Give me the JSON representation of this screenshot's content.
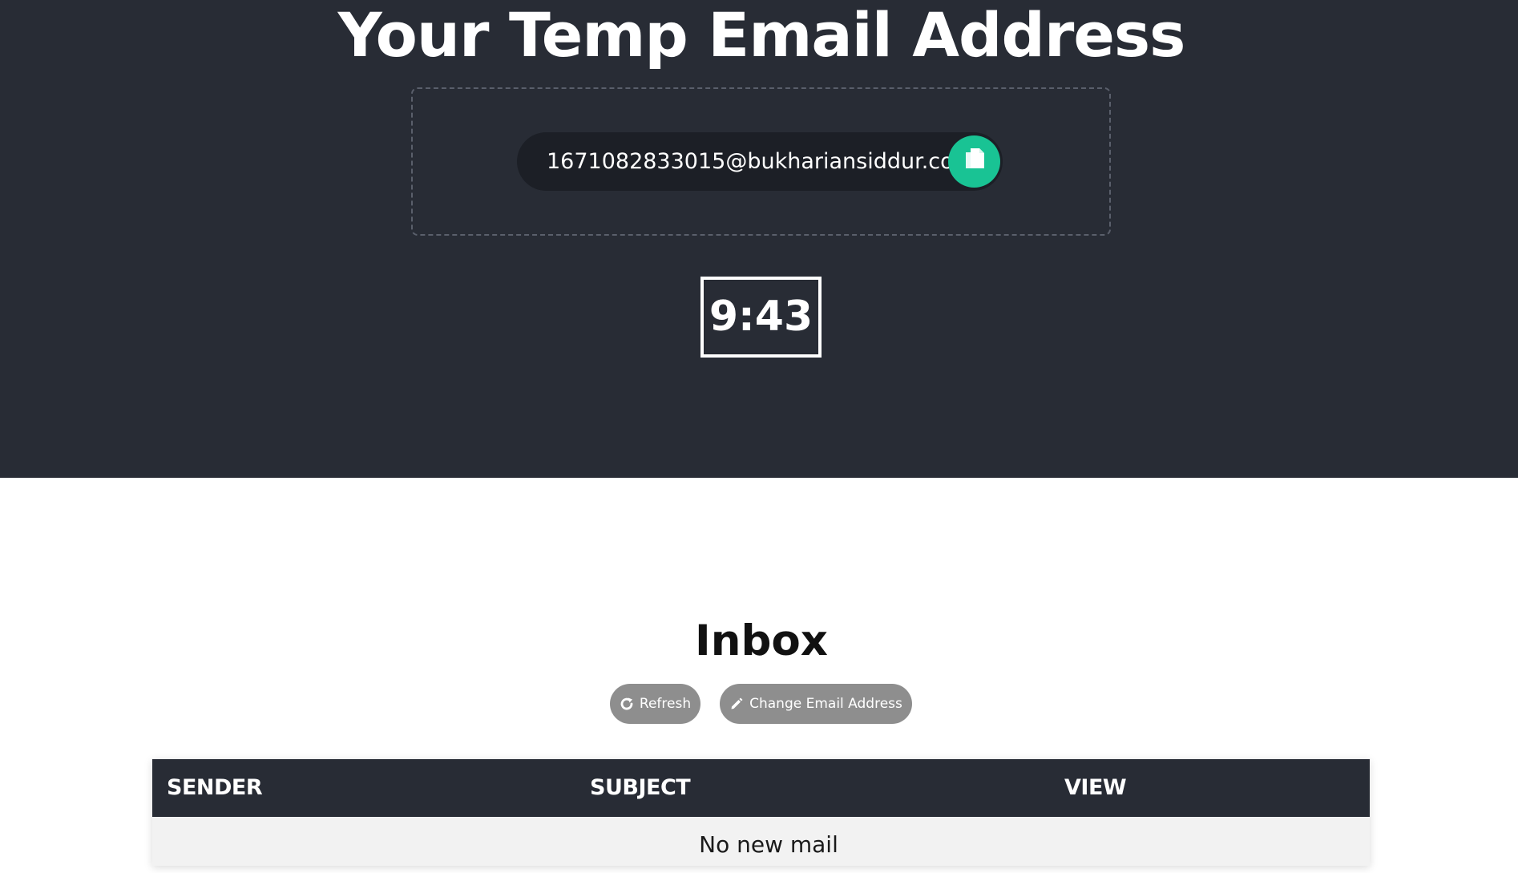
{
  "hero": {
    "title": "Your Temp Email Address",
    "email": "1671082833015@bukhariansiddur.com",
    "copy_icon": "copy-icon",
    "timer": "9:43"
  },
  "inbox": {
    "title": "Inbox",
    "refresh_label": "Refresh",
    "refresh_icon": "refresh-icon",
    "change_label": "Change Email Address",
    "change_icon": "pencil-icon",
    "columns": [
      "SENDER",
      "SUBJECT",
      "VIEW"
    ],
    "empty_message": "No new mail"
  },
  "colors": {
    "hero_bg": "#282c35",
    "accent": "#19c394",
    "button_gray": "#8e8e8e"
  }
}
